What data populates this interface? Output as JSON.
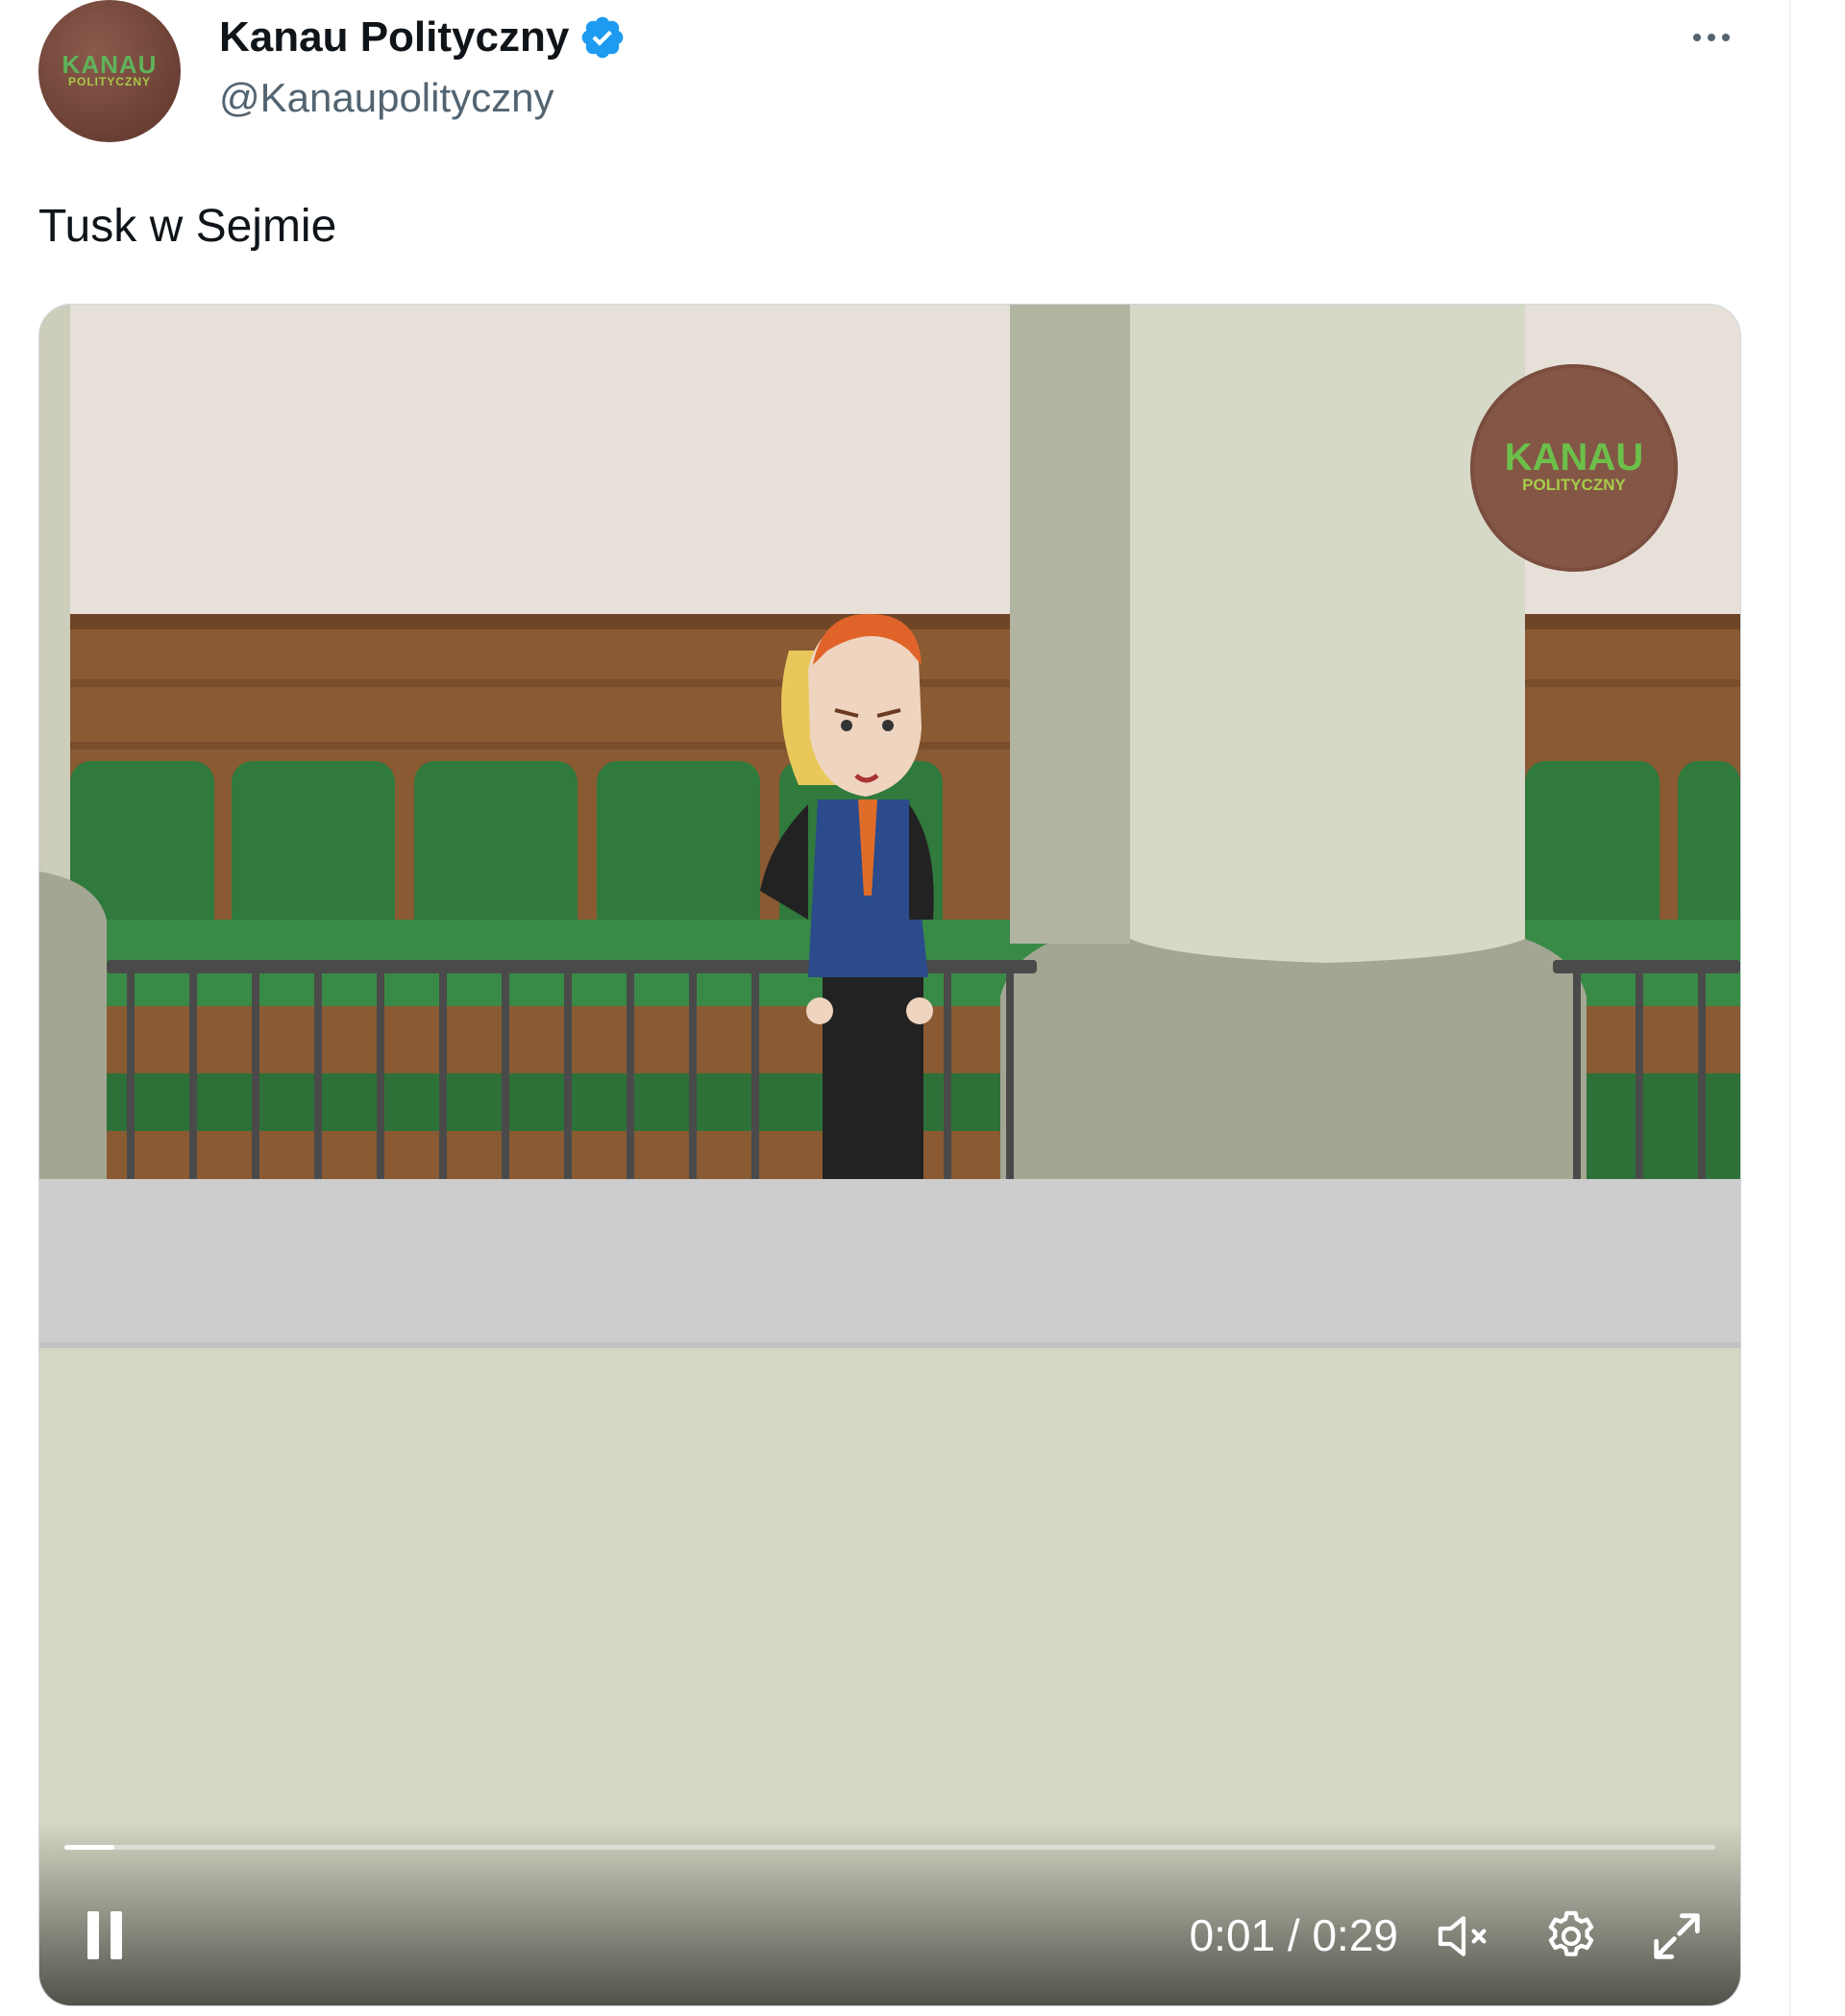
{
  "tweet": {
    "author": {
      "name": "Kanau Polityczny",
      "handle": "@Kanaupolityczny",
      "verified": true,
      "avatar_text": "KANAU",
      "avatar_subtext": "POLITYCZNY"
    },
    "more_icon": "more-horizontal-icon",
    "text": "Tusk w Sejmie"
  },
  "video": {
    "watermark_text": "KANAU",
    "watermark_subtext": "POLITYCZNY",
    "progress": 0.03,
    "time_display": "0:01 / 0:29",
    "muted": true,
    "playing": true,
    "controls": {
      "pause_icon": "pause-icon",
      "mute_icon": "volume-muted-icon",
      "settings_icon": "gear-icon",
      "fullscreen_icon": "fullscreen-icon"
    }
  },
  "colors": {
    "verified_badge": "#1d9bf0",
    "name_text": "#0f1419",
    "secondary_text": "#536471"
  }
}
